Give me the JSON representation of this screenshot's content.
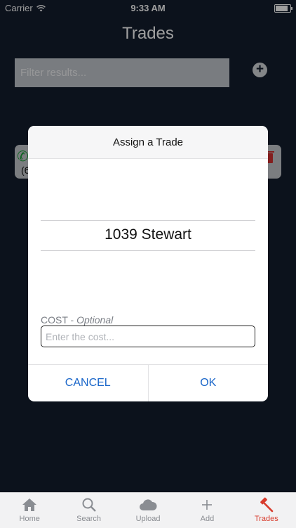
{
  "status_bar": {
    "carrier": "Carrier",
    "time": "9:33 AM"
  },
  "header": {
    "title": "Trades"
  },
  "filter": {
    "placeholder": "Filter results..."
  },
  "background_card": {
    "number_fragment": "(6"
  },
  "dialog": {
    "title": "Assign a Trade",
    "selected_value": "1039 Stewart",
    "cost_label": "COST -",
    "cost_label_optional": "Optional",
    "cost_placeholder": "Enter the cost...",
    "cancel_label": "CANCEL",
    "ok_label": "OK"
  },
  "tabs": [
    {
      "label": "Home",
      "icon": "home-icon"
    },
    {
      "label": "Search",
      "icon": "search-icon"
    },
    {
      "label": "Upload",
      "icon": "cloud-icon"
    },
    {
      "label": "Add",
      "icon": "plus-icon"
    },
    {
      "label": "Trades",
      "icon": "hammer-icon",
      "active": true
    }
  ],
  "colors": {
    "background": "#141d2e",
    "accent_link": "#1a66c9",
    "active_tab": "#d83b2c"
  }
}
